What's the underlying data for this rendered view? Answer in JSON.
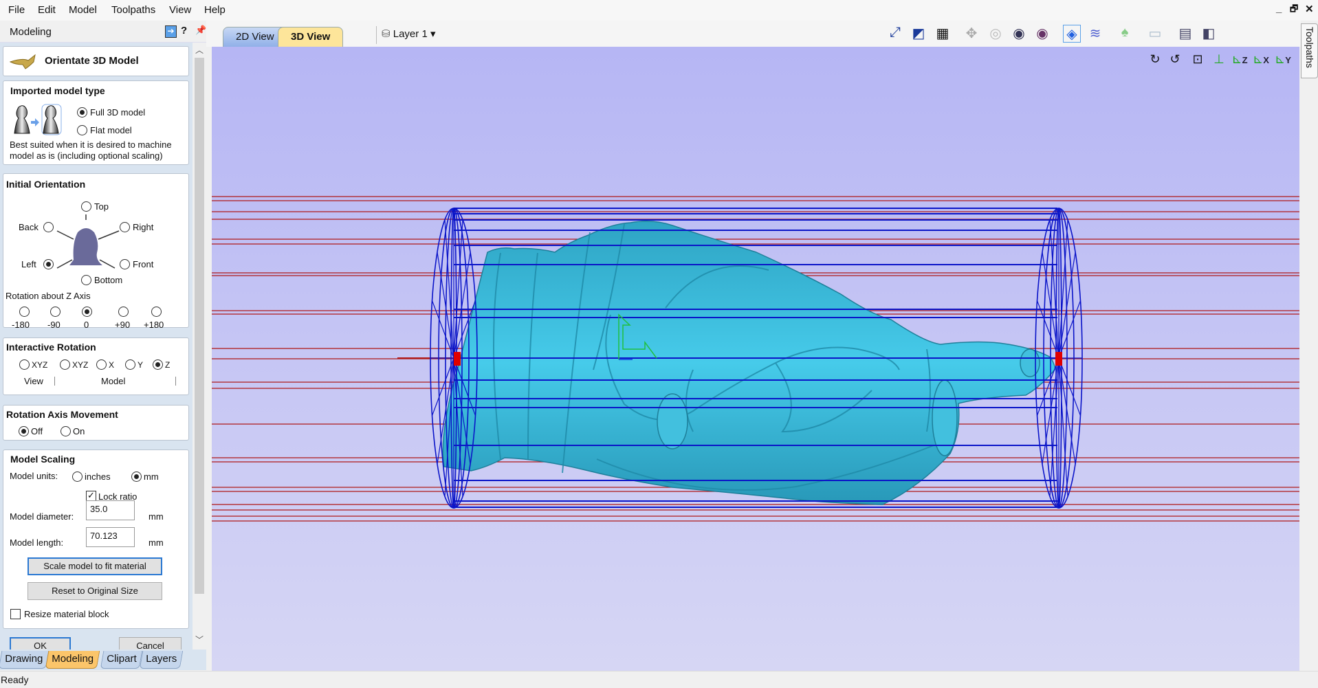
{
  "menu": [
    "File",
    "Edit",
    "Model",
    "Toolpaths",
    "View",
    "Help"
  ],
  "window_controls": {
    "minimize": "_",
    "restore": "🗗",
    "close": "✕"
  },
  "panel": {
    "header": "Modeling",
    "tool_title": "Orientate 3D Model",
    "imported": {
      "title": "Imported model type",
      "full": "Full 3D model",
      "flat": "Flat model",
      "selected": "Full 3D model",
      "description1": "Best suited when it is desired to machine",
      "description2": "model as is (including optional scaling)"
    },
    "orientation": {
      "title": "Initial Orientation",
      "top": "Top",
      "back": "Back",
      "right": "Right",
      "left": "Left",
      "front": "Front",
      "bottom": "Bottom",
      "selected": "Left",
      "rotation_label": "Rotation about Z Axis",
      "rotations": [
        "-180",
        "-90",
        "0",
        "+90",
        "+180"
      ],
      "rotation_selected": "0"
    },
    "interactive": {
      "title": "Interactive Rotation",
      "options": [
        "XYZ",
        "XYZ",
        "X",
        "Y",
        "Z"
      ],
      "selected": "Z",
      "view_label": "View",
      "model_label": "Model"
    },
    "axis_movement": {
      "title": "Rotation Axis Movement",
      "off": "Off",
      "on": "On",
      "selected": "Off"
    },
    "scaling": {
      "title": "Model Scaling",
      "units_label": "Model units:",
      "inches": "inches",
      "mm": "mm",
      "units_selected": "mm",
      "lock_ratio": "Lock ratio",
      "lock_ratio_checked": true,
      "diameter_label": "Model diameter:",
      "diameter_value": "35.0",
      "length_label": "Model length:",
      "length_value": "70.123",
      "unit": "mm",
      "scale_button": "Scale model to fit material",
      "reset_button": "Reset to Original Size",
      "resize_block": "Resize material block",
      "resize_block_checked": false
    },
    "ok": "OK",
    "cancel": "Cancel"
  },
  "bottom_tabs": [
    "Drawing",
    "Modeling",
    "Clipart",
    "Layers"
  ],
  "active_bottom_tab": "Modeling",
  "status": "Ready",
  "view_tabs": [
    "2D View",
    "3D View"
  ],
  "active_view_tab": "3D View",
  "layer": "Layer 1",
  "right_tab": "Toolpaths",
  "colors": {
    "viewport_top": "#b6b6f4",
    "viewport_bottom": "#d6d6f4",
    "model": "#3cc4e4",
    "wire_blue": "#0a14c8",
    "wire_red": "#b01818",
    "active_tab": "#fde59a"
  },
  "toolbar_icons": [
    "view-fit-icon",
    "2d-view-icon",
    "grid-icon",
    "pan-icon",
    "zoom-box-icon",
    "zoom-icon",
    "zoom-selected-icon",
    "toolpath-preview-icon",
    "toolpath-icon",
    "model-visibility-icon",
    "material-icon",
    "split-horizontal-icon",
    "split-vertical-icon"
  ],
  "view_icons": [
    "rotate-cw-icon",
    "rotate-ccw-icon",
    "fit-view-icon",
    "iso-view-icon",
    "view-z-icon",
    "view-x-icon",
    "view-y-icon"
  ],
  "view_icon_labels": [
    "",
    "",
    "",
    "",
    "Z",
    "X",
    "Y"
  ]
}
